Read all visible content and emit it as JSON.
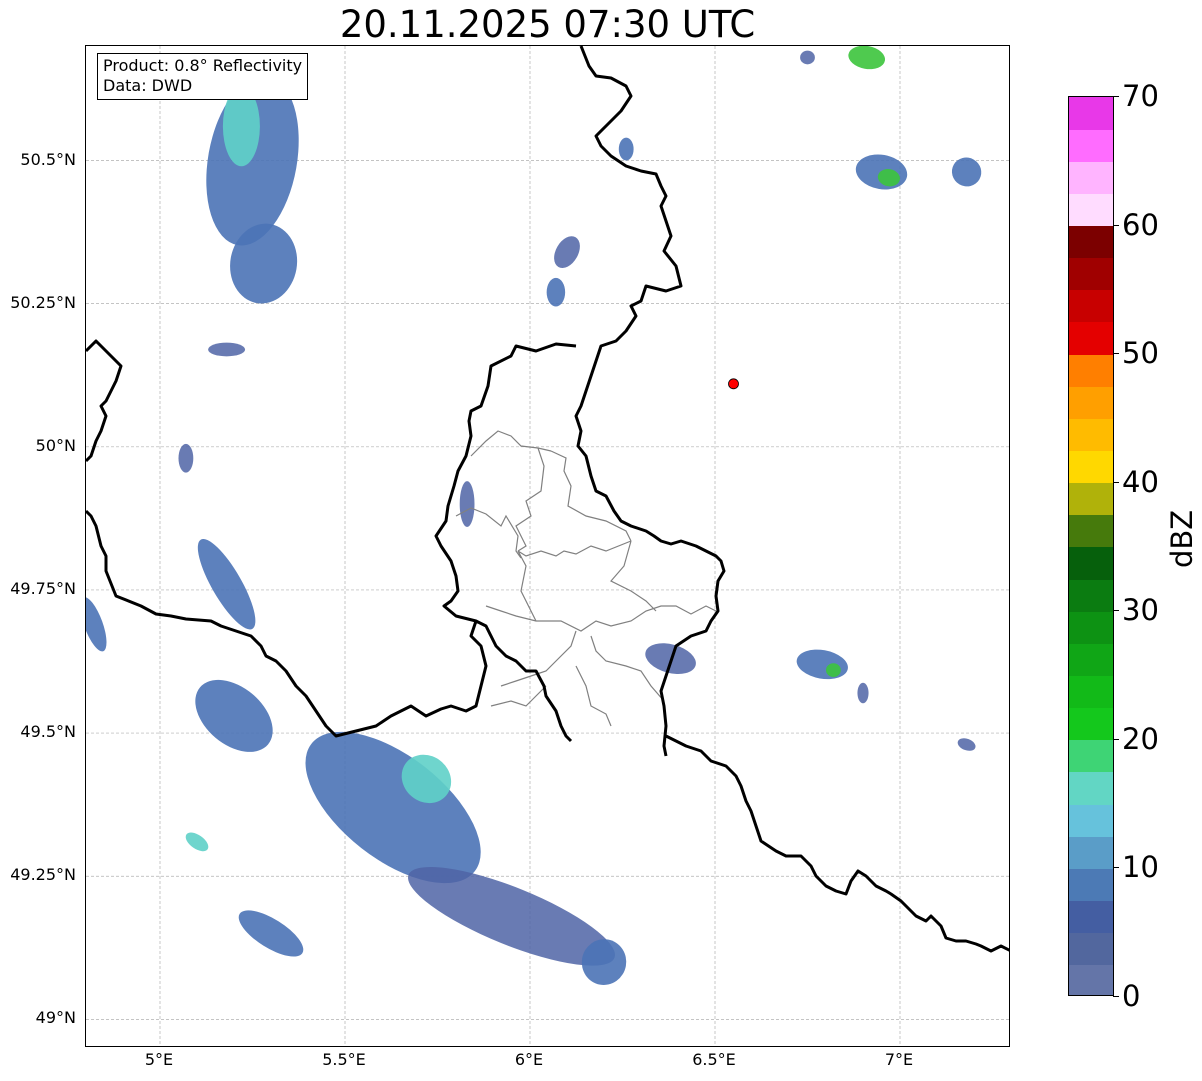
{
  "title": "20.11.2025 07:30 UTC",
  "info": {
    "product": "Product: 0.8° Reflectivity",
    "source": "Data: DWD"
  },
  "map": {
    "lon_range": [
      4.8,
      7.3
    ],
    "lat_range": [
      48.95,
      50.7
    ],
    "grid": true,
    "x_ticks": [
      {
        "value": 5.0,
        "label": "5°E"
      },
      {
        "value": 5.5,
        "label": "5.5°E"
      },
      {
        "value": 6.0,
        "label": "6°E"
      },
      {
        "value": 6.5,
        "label": "6.5°E"
      },
      {
        "value": 7.0,
        "label": "7°E"
      }
    ],
    "y_ticks": [
      {
        "value": 50.5,
        "label": "50.5°N"
      },
      {
        "value": 50.25,
        "label": "50.25°N"
      },
      {
        "value": 50.0,
        "label": "50°N"
      },
      {
        "value": 49.75,
        "label": "49.75°N"
      },
      {
        "value": 49.5,
        "label": "49.5°N"
      },
      {
        "value": 49.25,
        "label": "49.25°N"
      },
      {
        "value": 49.0,
        "label": "49°N"
      }
    ],
    "radar_site": {
      "lon": 6.55,
      "lat": 50.11,
      "color": "#ff0000"
    },
    "echo_cells": [
      {
        "lon": 5.25,
        "lat": 50.5,
        "rlon": 0.12,
        "rlat": 0.15,
        "angle": 10,
        "level": "mid"
      },
      {
        "lon": 5.28,
        "lat": 50.32,
        "rlon": 0.09,
        "rlat": 0.07,
        "angle": 10,
        "level": "mid"
      },
      {
        "lon": 5.22,
        "lat": 50.56,
        "rlon": 0.05,
        "rlat": 0.07,
        "angle": 0,
        "level": "high"
      },
      {
        "lon": 5.18,
        "lat": 50.17,
        "rlon": 0.05,
        "rlat": 0.012,
        "angle": 0,
        "level": "low"
      },
      {
        "lon": 5.07,
        "lat": 49.98,
        "rlon": 0.02,
        "rlat": 0.025,
        "angle": 0,
        "level": "low"
      },
      {
        "lon": 5.18,
        "lat": 49.76,
        "rlon": 0.04,
        "rlat": 0.09,
        "angle": -30,
        "level": "mid"
      },
      {
        "lon": 4.82,
        "lat": 49.69,
        "rlon": 0.025,
        "rlat": 0.05,
        "angle": -20,
        "level": "mid"
      },
      {
        "lon": 5.2,
        "lat": 49.53,
        "rlon": 0.12,
        "rlat": 0.05,
        "angle": 40,
        "level": "mid"
      },
      {
        "lon": 5.63,
        "lat": 49.37,
        "rlon": 0.28,
        "rlat": 0.09,
        "angle": 38,
        "level": "mid"
      },
      {
        "lon": 5.95,
        "lat": 49.18,
        "rlon": 0.3,
        "rlat": 0.05,
        "angle": 22,
        "level": "low"
      },
      {
        "lon": 5.72,
        "lat": 49.42,
        "rlon": 0.07,
        "rlat": 0.04,
        "angle": 40,
        "level": "high"
      },
      {
        "lon": 5.3,
        "lat": 49.15,
        "rlon": 0.1,
        "rlat": 0.025,
        "angle": 32,
        "level": "mid"
      },
      {
        "lon": 5.1,
        "lat": 49.31,
        "rlon": 0.035,
        "rlat": 0.012,
        "angle": 35,
        "level": "high"
      },
      {
        "lon": 6.2,
        "lat": 49.1,
        "rlon": 0.06,
        "rlat": 0.04,
        "angle": 10,
        "level": "mid"
      },
      {
        "lon": 6.26,
        "lat": 50.52,
        "rlon": 0.02,
        "rlat": 0.02,
        "angle": 0,
        "level": "mid"
      },
      {
        "lon": 6.1,
        "lat": 50.34,
        "rlon": 0.03,
        "rlat": 0.03,
        "angle": 30,
        "level": "low"
      },
      {
        "lon": 6.07,
        "lat": 50.27,
        "rlon": 0.025,
        "rlat": 0.025,
        "angle": 0,
        "level": "mid"
      },
      {
        "lon": 5.83,
        "lat": 49.9,
        "rlon": 0.02,
        "rlat": 0.04,
        "angle": 0,
        "level": "low"
      },
      {
        "lon": 6.95,
        "lat": 50.48,
        "rlon": 0.07,
        "rlat": 0.03,
        "angle": 10,
        "level": "mid"
      },
      {
        "lon": 6.97,
        "lat": 50.47,
        "rlon": 0.03,
        "rlat": 0.015,
        "angle": 10,
        "level": "green"
      },
      {
        "lon": 7.18,
        "lat": 50.48,
        "rlon": 0.04,
        "rlat": 0.025,
        "angle": 30,
        "level": "mid"
      },
      {
        "lon": 6.91,
        "lat": 50.68,
        "rlon": 0.05,
        "rlat": 0.02,
        "angle": 10,
        "level": "green"
      },
      {
        "lon": 6.79,
        "lat": 49.62,
        "rlon": 0.07,
        "rlat": 0.025,
        "angle": 10,
        "level": "mid"
      },
      {
        "lon": 6.82,
        "lat": 49.61,
        "rlon": 0.02,
        "rlat": 0.012,
        "angle": 0,
        "level": "green"
      },
      {
        "lon": 6.38,
        "lat": 49.63,
        "rlon": 0.07,
        "rlat": 0.025,
        "angle": 15,
        "level": "low"
      },
      {
        "lon": 6.9,
        "lat": 49.57,
        "rlon": 0.015,
        "rlat": 0.018,
        "angle": 0,
        "level": "low"
      },
      {
        "lon": 7.18,
        "lat": 49.48,
        "rlon": 0.025,
        "rlat": 0.01,
        "angle": 20,
        "level": "low"
      },
      {
        "lon": 6.75,
        "lat": 50.68,
        "rlon": 0.02,
        "rlat": 0.012,
        "angle": 0,
        "level": "low"
      }
    ],
    "level_colors": {
      "low": "#4f64a6",
      "mid": "#4b73b6",
      "high": "#5fd0c8",
      "green": "#3cc43c"
    }
  },
  "colorbar": {
    "unit": "dBZ",
    "min": 0,
    "max": 70,
    "tick_labels": [
      {
        "value": 0,
        "label": "0"
      },
      {
        "value": 10,
        "label": "10"
      },
      {
        "value": 20,
        "label": "20"
      },
      {
        "value": 30,
        "label": "30"
      },
      {
        "value": 40,
        "label": "40"
      },
      {
        "value": 50,
        "label": "50"
      },
      {
        "value": 60,
        "label": "60"
      },
      {
        "value": 70,
        "label": "70"
      }
    ],
    "segments": [
      {
        "from": 0,
        "to": 2.5,
        "color": "#6475a8"
      },
      {
        "from": 2.5,
        "to": 5,
        "color": "#52679e"
      },
      {
        "from": 5,
        "to": 7.5,
        "color": "#445ea2"
      },
      {
        "from": 7.5,
        "to": 10,
        "color": "#4c7ab5"
      },
      {
        "from": 10,
        "to": 12.5,
        "color": "#5a9dc8"
      },
      {
        "from": 12.5,
        "to": 15,
        "color": "#66c2dc"
      },
      {
        "from": 15,
        "to": 17.5,
        "color": "#62d6c4"
      },
      {
        "from": 17.5,
        "to": 20,
        "color": "#3ed475"
      },
      {
        "from": 20,
        "to": 22.5,
        "color": "#14c81c"
      },
      {
        "from": 22.5,
        "to": 25,
        "color": "#12ba18"
      },
      {
        "from": 25,
        "to": 27.5,
        "color": "#10a616"
      },
      {
        "from": 27.5,
        "to": 30,
        "color": "#0d9213"
      },
      {
        "from": 30,
        "to": 32.5,
        "color": "#0b7c11"
      },
      {
        "from": 32.5,
        "to": 35,
        "color": "#06600c"
      },
      {
        "from": 35,
        "to": 37.5,
        "color": "#467a0c"
      },
      {
        "from": 37.5,
        "to": 40,
        "color": "#b0b20a"
      },
      {
        "from": 40,
        "to": 42.5,
        "color": "#ffd800"
      },
      {
        "from": 42.5,
        "to": 45,
        "color": "#ffbb00"
      },
      {
        "from": 45,
        "to": 47.5,
        "color": "#ff9f00"
      },
      {
        "from": 47.5,
        "to": 50,
        "color": "#ff7f00"
      },
      {
        "from": 50,
        "to": 52.5,
        "color": "#e40000"
      },
      {
        "from": 52.5,
        "to": 55,
        "color": "#c80000"
      },
      {
        "from": 55,
        "to": 57.5,
        "color": "#a00000"
      },
      {
        "from": 57.5,
        "to": 60,
        "color": "#7c0000"
      },
      {
        "from": 60,
        "to": 62.5,
        "color": "#ffdcff"
      },
      {
        "from": 62.5,
        "to": 65,
        "color": "#ffb4ff"
      },
      {
        "from": 65,
        "to": 67.5,
        "color": "#ff6cff"
      },
      {
        "from": 67.5,
        "to": 70,
        "color": "#e838e8"
      }
    ]
  }
}
